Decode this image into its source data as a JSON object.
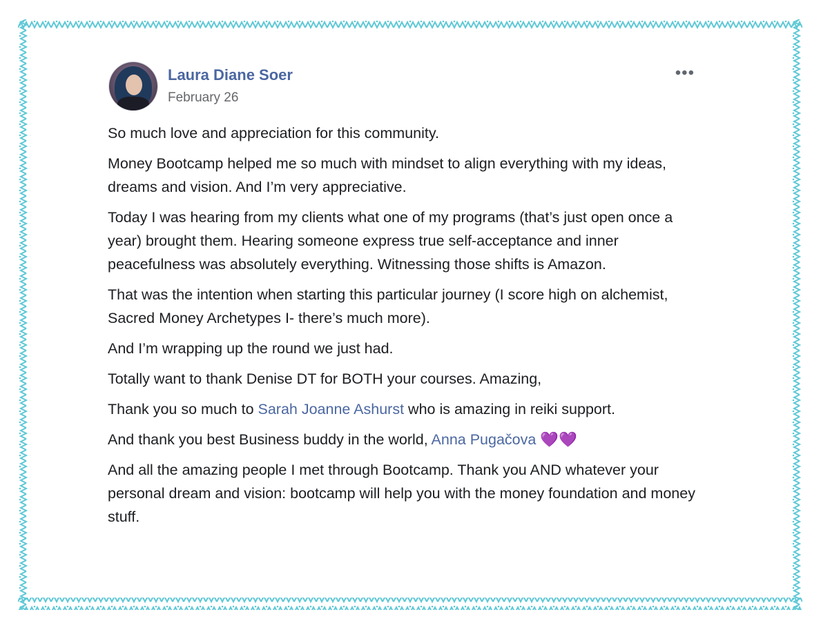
{
  "post": {
    "author": "Laura Diane Soer",
    "date": "February 26",
    "more_menu": "•••",
    "paragraphs": {
      "p1": "So much love and appreciation for this community.",
      "p2": "Money Bootcamp helped me so much with mindset to align everything with my ideas, dreams and vision. And I’m very appreciative.",
      "p3": "Today I was hearing from my clients what one of my programs (that’s just open once a year) brought them. Hearing someone express true self-acceptance and inner peacefulness was absolutely everything. Witnessing those shifts is Amazon.",
      "p4": "That was the intention when starting this particular journey (I score high on alchemist, Sacred Money Archetypes I- there’s much more).",
      "p5": "And I’m wrapping up the round we just had.",
      "p6": "Totally want to thank Denise DT for BOTH your courses. Amazing,",
      "p7_before": "Thank you so much to ",
      "p7_mention": "Sarah Joanne Ashurst",
      "p7_after": " who is amazing in reiki support.",
      "p8_before": "And thank you best Business buddy in the world, ",
      "p8_mention": "Anna Pugačova",
      "p8_emoji": "💜💜",
      "p9": "And all the amazing people I met through Bootcamp. Thank you AND whatever your personal dream and vision: bootcamp will help you with the money foundation and money stuff."
    }
  },
  "colors": {
    "border_pattern": "#5ec8d6",
    "author_link": "#4b67a1",
    "date_text": "#65676b",
    "body_text": "#1c1e21",
    "heart_emoji": "#9b3cf0"
  },
  "icons": {
    "more": "more-options-icon",
    "avatar": "profile-photo"
  }
}
